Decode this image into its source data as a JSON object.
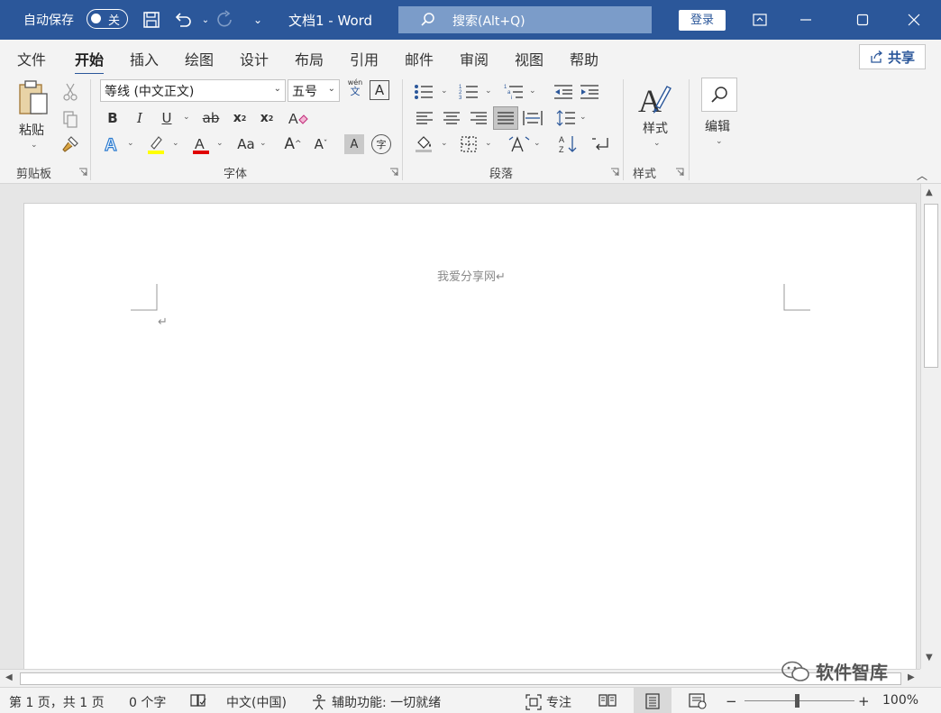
{
  "titlebar": {
    "autosave_label": "自动保存",
    "autosave_state": "关",
    "doc_title": "文档1  -  Word",
    "search_label": "搜索(Alt+Q)",
    "login_label": "登录"
  },
  "tabs": [
    {
      "label": "文件"
    },
    {
      "label": "开始"
    },
    {
      "label": "插入"
    },
    {
      "label": "绘图"
    },
    {
      "label": "设计"
    },
    {
      "label": "布局"
    },
    {
      "label": "引用"
    },
    {
      "label": "邮件"
    },
    {
      "label": "审阅"
    },
    {
      "label": "视图"
    },
    {
      "label": "帮助"
    }
  ],
  "active_tab": "开始",
  "share_label": "共享",
  "ribbon": {
    "clipboard": {
      "paste_label": "粘贴",
      "group_label": "剪贴板"
    },
    "font": {
      "font_name": "等线 (中文正文)",
      "font_size": "五号",
      "group_label": "字体",
      "wen_label": "wén",
      "wen_char": "文",
      "border_char": "A",
      "bold": "B",
      "italic": "I",
      "underline": "U",
      "strike": "ab",
      "sub": "x",
      "sup": "x",
      "aa": "Aa",
      "grow": "A",
      "shrink": "A",
      "shade": "A",
      "circle": "字"
    },
    "paragraph": {
      "group_label": "段落"
    },
    "styles": {
      "styles_label": "样式",
      "group_label": "样式"
    },
    "editing": {
      "editing_label": "编辑"
    }
  },
  "document": {
    "header_text": "我爱分享网↵",
    "para_mark": "↵"
  },
  "watermark": "软件智库",
  "statusbar": {
    "page": "第 1 页，共 1 页",
    "words": "0 个字",
    "language": "中文(中国)",
    "accessibility": "辅助功能: 一切就绪",
    "focus": "专注",
    "zoom": "100%",
    "zoom_minus": "−",
    "zoom_plus": "+"
  },
  "colors": {
    "titlebar": "#2b579a",
    "highlight": "#ffff00",
    "font_color": "#e00000"
  }
}
